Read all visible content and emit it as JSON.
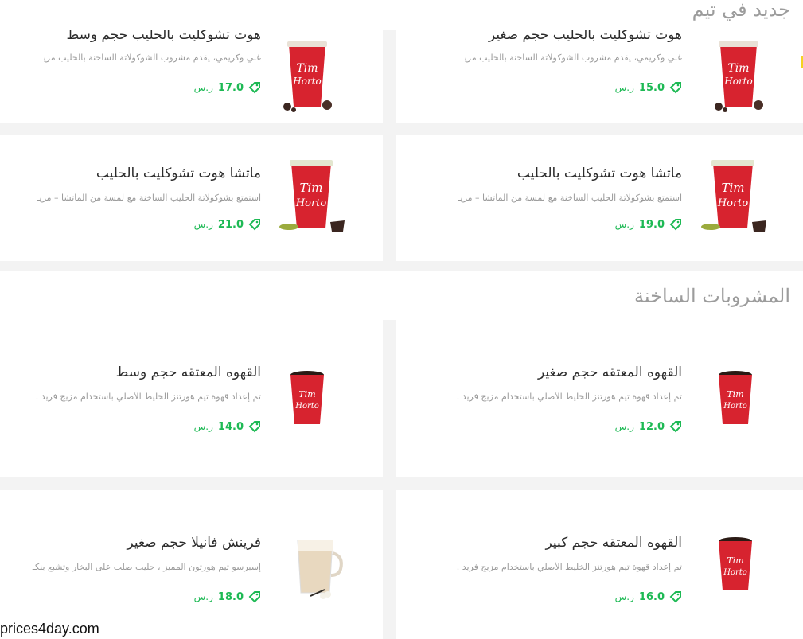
{
  "sections": [
    {
      "title": "جديد في تيم",
      "items": [
        {
          "name": "هوت تشوكليت بالحليب حجم صغير",
          "desc": "غني وكريمي، يقدم مشروب الشوكولاتة الساخنة بالحليب مزيـ",
          "price": "15.0",
          "currency": "ر.س",
          "image": "cup-chocolate"
        },
        {
          "name": "هوت تشوكليت بالحليب حجم وسط",
          "desc": "غني وكريمي، يقدم مشروب الشوكولاتة الساخنة بالحليب مزيـ",
          "price": "17.0",
          "currency": "ر.س",
          "image": "cup-chocolate"
        },
        {
          "name": "ماتشا هوت تشوكليت بالحليب",
          "desc": "استمتع بشوكولاتة الحليب الساخنة مع لمسة من الماتشا – مزيـ",
          "price": "19.0",
          "currency": "ر.س",
          "image": "cup-matcha"
        },
        {
          "name": "ماتشا هوت تشوكليت بالحليب",
          "desc": "استمتع بشوكولاتة الحليب الساخنة مع لمسة من الماتشا – مزيـ",
          "price": "21.0",
          "currency": "ر.س",
          "image": "cup-matcha"
        }
      ]
    },
    {
      "title": "المشروبات الساخنة",
      "items": [
        {
          "name": "القهوه المعتقه حجم صغير",
          "desc": "تم إعداد قهوة تيم هورتنز الخليط الأصلي باستخدام مزيج فريد .",
          "price": "12.0",
          "currency": "ر.س",
          "image": "cup-coffee"
        },
        {
          "name": "القهوه المعتقه حجم وسط",
          "desc": "تم إعداد قهوة تيم هورتنز الخليط الأصلي باستخدام مزيج فريد .",
          "price": "14.0",
          "currency": "ر.س",
          "image": "cup-coffee"
        },
        {
          "name": "القهوه المعتقه حجم كبير",
          "desc": "تم إعداد قهوة تيم هورتنز الخليط الأصلي باستخدام مزيج فريد .",
          "price": "16.0",
          "currency": "ر.س",
          "image": "cup-coffee"
        },
        {
          "name": "فرينش فانيلا حجم صغير",
          "desc": "إسبرسو تيم هورتون المميز ، حليب صلب على البخار وتشبع بنكـ",
          "price": "18.0",
          "currency": "ر.س",
          "image": "glass-vanilla"
        }
      ]
    }
  ],
  "brand": {
    "cup_text_line1": "Tim",
    "cup_text_line2": "Horto"
  },
  "watermark": "prices4day.com",
  "colors": {
    "price_green": "#1db954",
    "cup_red": "#d7232f"
  }
}
